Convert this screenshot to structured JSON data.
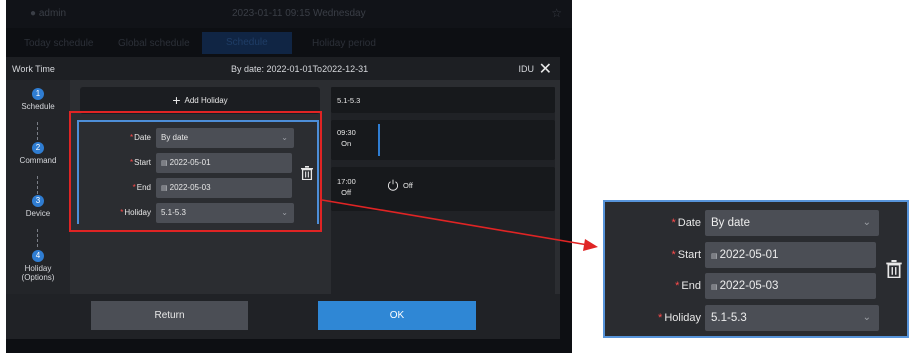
{
  "background": {
    "user": "admin",
    "clock": "2023-01-11 09:15 Wednesday",
    "tabs": [
      "Today schedule",
      "Global schedule",
      "Schedule",
      "Holiday period"
    ],
    "active_tab_index": 2
  },
  "dialog": {
    "title": "Work Time",
    "by_date_label": "By date: 2022-01-01To2022-12-31",
    "device_type": "IDU",
    "steps": [
      {
        "num": "1",
        "label": "Schedule"
      },
      {
        "num": "2",
        "label": "Command"
      },
      {
        "num": "3",
        "label": "Device"
      },
      {
        "num": "4",
        "label": "Holiday",
        "label2": "(Options)"
      }
    ],
    "add_holiday": "Add Holiday",
    "form": {
      "date_label": "Date",
      "date_value": "By date",
      "start_label": "Start",
      "start_value": "2022-05-01",
      "end_label": "End",
      "end_value": "2022-05-03",
      "holiday_label": "Holiday",
      "holiday_value": "5.1-5.3"
    },
    "right_panel": {
      "period": "5.1-5.3",
      "entries": [
        {
          "time": "09:30",
          "state": "On"
        },
        {
          "time": "17:00",
          "state": "Off",
          "action": "Off"
        }
      ]
    },
    "buttons": {
      "return": "Return",
      "ok": "OK"
    }
  },
  "colors": {
    "accent": "#2f87d5",
    "highlight": "#e02424",
    "required": "#ff4a4a",
    "callout_border": "#5794da"
  }
}
